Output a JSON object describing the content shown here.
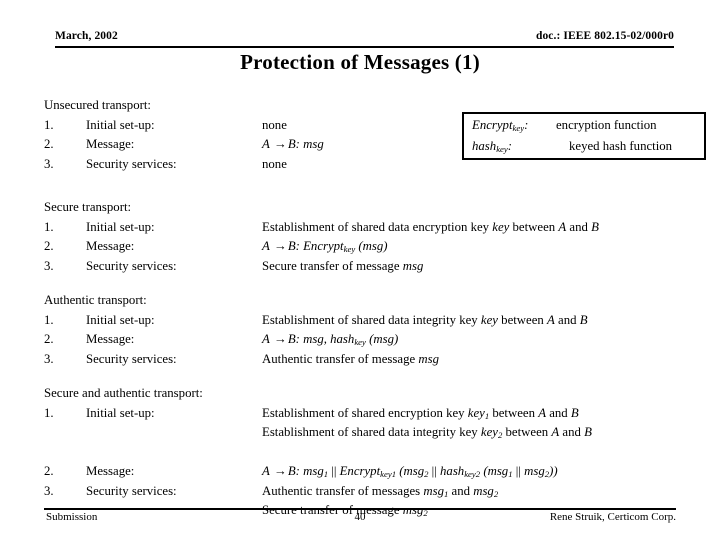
{
  "header": {
    "date": "March, 2002",
    "doc_number": "doc.: IEEE 802.15-02/000r0",
    "title": "Protection of Messages (1)"
  },
  "legend": {
    "rows": [
      {
        "term_html": "Encrypt<sub>key</sub>:",
        "description": "encryption function"
      },
      {
        "term_html": "hash<sub>key</sub>:",
        "description": "keyed hash function"
      }
    ]
  },
  "sections": [
    {
      "heading": "Unsecured transport:",
      "items": [
        {
          "number": "1.",
          "label": "Initial set-up:",
          "values_html": [
            "none"
          ]
        },
        {
          "number": "2.",
          "label": "Message:",
          "values_html": [
            "<i>A</i> <span class=\"arrow\">&#8594;</span><i>B: msg</i>"
          ]
        },
        {
          "number": "3.",
          "label": "Security services:",
          "values_html": [
            "none"
          ]
        }
      ]
    },
    {
      "heading": "Secure transport:",
      "items": [
        {
          "number": "1.",
          "label": "Initial set-up:",
          "values_html": [
            "Establishment of shared data encryption key <i>key</i> between <i>A</i> and <i>B</i>"
          ]
        },
        {
          "number": "2.",
          "label": "Message:",
          "values_html": [
            "<i>A</i> <span class=\"arrow\">&#8594;</span><i>B: Encrypt<sub>key</sub> (msg)</i>"
          ]
        },
        {
          "number": "3.",
          "label": "Security services:",
          "values_html": [
            "Secure transfer of message <i>msg</i>"
          ]
        }
      ]
    },
    {
      "heading": "Authentic transport:",
      "items": [
        {
          "number": "1.",
          "label": "Initial set-up:",
          "values_html": [
            "Establishment of shared data integrity key <i>key</i> between <i>A</i> and <i>B</i>"
          ]
        },
        {
          "number": "2.",
          "label": "Message:",
          "values_html": [
            "<i>A</i> <span class=\"arrow\">&#8594;</span><i>B: msg, hash<sub>key</sub> (msg)</i>"
          ]
        },
        {
          "number": "3.",
          "label": "Security services:",
          "values_html": [
            "Authentic transfer of message <i>msg</i>"
          ]
        }
      ]
    },
    {
      "heading": "Secure and authentic transport:",
      "items": [
        {
          "number": "1.",
          "label": "Initial set-up:",
          "values_html": [
            "Establishment of shared encryption key <i>key<sub>1</sub></i> between <i>A</i> and <i>B</i>",
            "Establishment of shared data integrity key <i>key<sub>2</sub></i> between <i>A</i> and <i>B</i>"
          ]
        },
        {
          "number": "2.",
          "label": "Message:",
          "values_html": [
            "<i>A</i> <span class=\"arrow\">&#8594;</span><i>B: msg<sub>1</sub></i> || <i>Encrypt<sub>key1</sub> (msg<sub>2</sub></i> || <i>hash<sub>key2</sub> (msg<sub>1</sub></i> || <i>msg<sub>2</sub>))</i>"
          ]
        },
        {
          "number": "3.",
          "label": "Security services:",
          "values_html": [
            "Authentic transfer of messages <i>msg<sub>1</sub></i> and <i>msg<sub>2</sub></i>",
            "Secure transfer of message <i>msg<sub>2</sub></i>"
          ]
        }
      ]
    }
  ],
  "footer": {
    "left": "Submission",
    "page": "40",
    "right": "Rene Struik, Certicom Corp."
  }
}
